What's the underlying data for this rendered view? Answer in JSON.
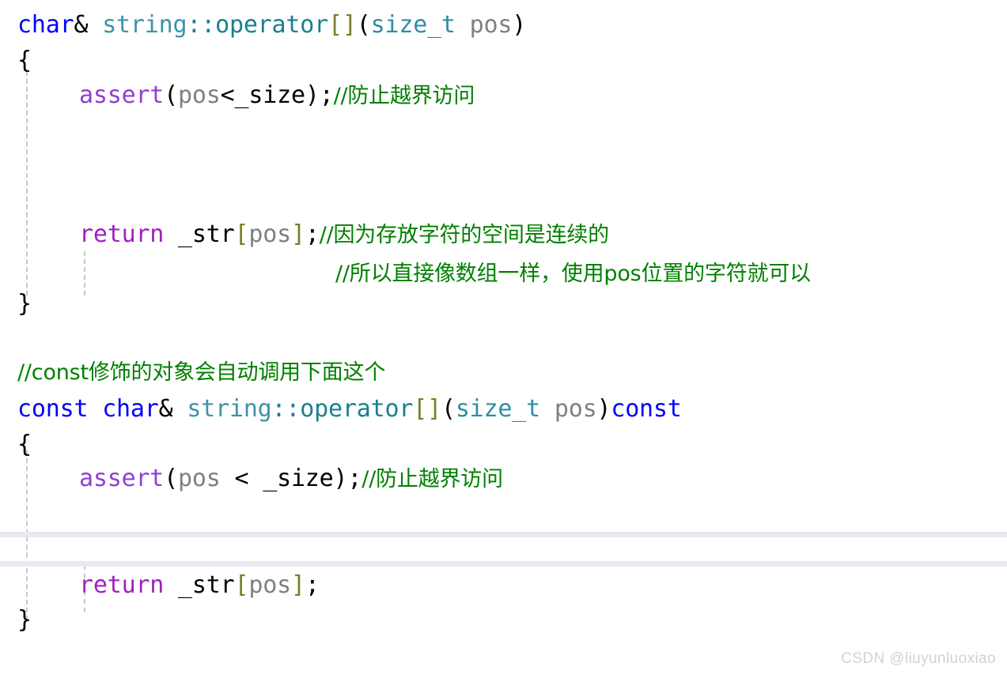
{
  "editor": {
    "background": "#ffffff",
    "indent_guide_color": "#c8c8c8",
    "rule_color": "#e9e9f2"
  },
  "colors": {
    "keyword": "#0000ff",
    "type": "#2f8da5",
    "class_name": "#3f92a8",
    "operator_kw": "#1a7f8e",
    "macro": "#8f3fd4",
    "control": "#a020c0",
    "variable": "#808080",
    "plain": "#000000",
    "bracket": "#7d7d28",
    "comment": "#008000",
    "watermark": "#d2d2d2"
  },
  "code": {
    "line1": {
      "kw_char": "char",
      "amp": "& ",
      "cls_string": "string",
      "scope": "::",
      "op_operator": "operator",
      "brk_open": "[",
      "brk_close": "]",
      "paren_open": "(",
      "type_size_t": "size_t",
      "space": " ",
      "var_pos": "pos",
      "paren_close": ")"
    },
    "line2": {
      "brace_open": "{"
    },
    "line3": {
      "macro_assert": "assert",
      "paren_open": "(",
      "var_pos": "pos",
      "plain_expr": "<_size",
      "paren_close": ")",
      "semi": ";",
      "comment": "//防止越界访问"
    },
    "line4": {
      "ctrl_return": "return",
      "space": " ",
      "plain_str": "_str",
      "brk_open": "[",
      "var_pos": "pos",
      "brk_close": "]",
      "semi": ";",
      "comment": "//因为存放字符的空间是连续的"
    },
    "line5": {
      "comment": "//所以直接像数组一样，使用pos位置的字符就可以"
    },
    "line6": {
      "brace_close": "}"
    },
    "line7": {
      "comment": "//const修饰的对象会自动调用下面这个"
    },
    "line8": {
      "kw_const": "const",
      "space1": " ",
      "kw_char": "char",
      "amp": "& ",
      "cls_string": "string",
      "scope": "::",
      "op_operator": "operator",
      "brk_open": "[",
      "brk_close": "]",
      "paren_open": "(",
      "type_size_t": "size_t",
      "space2": " ",
      "var_pos": "pos",
      "paren_close": ")",
      "kw_const_trailing": "const"
    },
    "line9": {
      "brace_open": "{"
    },
    "line10": {
      "macro_assert": "assert",
      "paren_open": "(",
      "var_pos": "pos",
      "plain_expr": " < _size",
      "paren_close": ")",
      "semi": ";",
      "comment": "//防止越界访问"
    },
    "line11": {
      "ctrl_return": "return",
      "space": " ",
      "plain_str": "_str",
      "brk_open": "[",
      "var_pos": "pos",
      "brk_close": "]",
      "semi": ";"
    },
    "line12": {
      "brace_close": "}"
    }
  },
  "watermark": {
    "text": "CSDN @liuyunluoxiao"
  }
}
